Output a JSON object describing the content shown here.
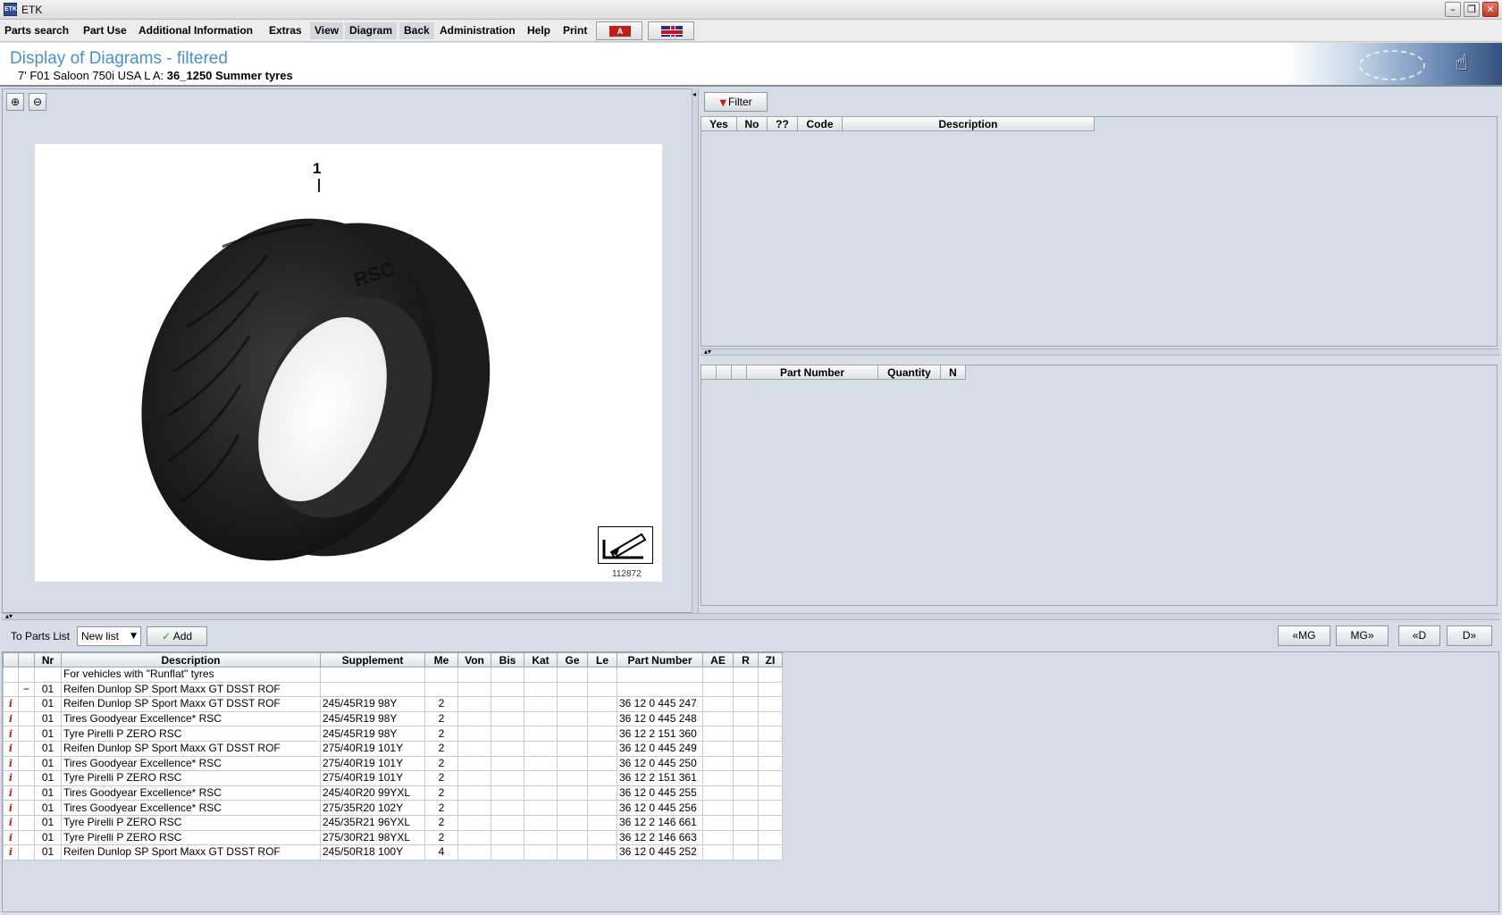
{
  "window": {
    "title": "ETK",
    "icon_text": "ETK"
  },
  "menu": {
    "items": [
      "Parts search",
      "Part Use",
      "Additional Information",
      "Extras",
      "View",
      "Diagram",
      "Back",
      "Administration",
      "Help",
      "Print"
    ]
  },
  "header": {
    "title": "Display of Diagrams - filtered",
    "vehicle": "7' F01 Saloon 750i USA  L A:",
    "group": "36_1250 Summer tyres"
  },
  "diagram": {
    "callout": "1",
    "image_id": "112872",
    "zoom_in_icon": "zoom-in-icon",
    "zoom_out_icon": "zoom-out-icon"
  },
  "filter_panel": {
    "button_label": "Filter",
    "columns": [
      "Yes",
      "No",
      "??",
      "Code",
      "Description"
    ]
  },
  "part_panel": {
    "columns": [
      "",
      "",
      "",
      "Part Number",
      "Quantity",
      "N"
    ]
  },
  "toolbar": {
    "to_parts_list_label": "To Parts List",
    "list_select_value": "New list",
    "add_label": "Add",
    "nav": [
      "«MG",
      "MG»",
      "«D",
      "D»"
    ]
  },
  "parts": {
    "columns": [
      "",
      "",
      "Nr",
      "Description",
      "Supplement",
      "Me",
      "Von",
      "Bis",
      "Kat",
      "Ge",
      "Le",
      "Part Number",
      "AE",
      "R",
      "ZI"
    ],
    "rows": [
      {
        "info": "",
        "tree": "",
        "nr": "",
        "desc": "For vehicles with \"Runflat\" tyres",
        "supp": "",
        "me": "",
        "pn": ""
      },
      {
        "info": "",
        "tree": "−",
        "nr": "01",
        "desc": "Reifen Dunlop SP Sport Maxx GT DSST ROF",
        "supp": "",
        "me": "",
        "pn": ""
      },
      {
        "info": "i",
        "tree": "",
        "nr": "01",
        "desc": "Reifen Dunlop SP Sport Maxx GT DSST ROF",
        "supp": "245/45R19 98Y",
        "me": "2",
        "pn": "36 12 0 445 247"
      },
      {
        "info": "i",
        "tree": "",
        "nr": "01",
        "desc": "Tires Goodyear Excellence* RSC",
        "supp": "245/45R19 98Y",
        "me": "2",
        "pn": "36 12 0 445 248"
      },
      {
        "info": "i",
        "tree": "",
        "nr": "01",
        "desc": "Tyre Pirelli P ZERO RSC",
        "supp": "245/45R19 98Y",
        "me": "2",
        "pn": "36 12 2 151 360"
      },
      {
        "info": "i",
        "tree": "",
        "nr": "01",
        "desc": "Reifen Dunlop SP Sport Maxx GT DSST ROF",
        "supp": "275/40R19 101Y",
        "me": "2",
        "pn": "36 12 0 445 249"
      },
      {
        "info": "i",
        "tree": "",
        "nr": "01",
        "desc": "Tires Goodyear Excellence* RSC",
        "supp": "275/40R19 101Y",
        "me": "2",
        "pn": "36 12 0 445 250"
      },
      {
        "info": "i",
        "tree": "",
        "nr": "01",
        "desc": "Tyre Pirelli P ZERO RSC",
        "supp": "275/40R19 101Y",
        "me": "2",
        "pn": "36 12 2 151 361"
      },
      {
        "info": "i",
        "tree": "",
        "nr": "01",
        "desc": "Tires Goodyear Excellence* RSC",
        "supp": "245/40R20 99YXL",
        "me": "2",
        "pn": "36 12 0 445 255"
      },
      {
        "info": "i",
        "tree": "",
        "nr": "01",
        "desc": "Tires Goodyear Excellence* RSC",
        "supp": "275/35R20 102Y",
        "me": "2",
        "pn": "36 12 0 445 256"
      },
      {
        "info": "i",
        "tree": "",
        "nr": "01",
        "desc": "Tyre Pirelli P ZERO RSC",
        "supp": "245/35R21 96YXL",
        "me": "2",
        "pn": "36 12 2 146 661"
      },
      {
        "info": "i",
        "tree": "",
        "nr": "01",
        "desc": "Tyre Pirelli P ZERO RSC",
        "supp": "275/30R21 98YXL",
        "me": "2",
        "pn": "36 12 2 146 663"
      },
      {
        "info": "i",
        "tree": "",
        "nr": "01",
        "desc": "Reifen Dunlop SP Sport Maxx GT DSST ROF",
        "supp": "245/50R18 100Y",
        "me": "4",
        "pn": "36 12 0 445 252"
      }
    ]
  }
}
